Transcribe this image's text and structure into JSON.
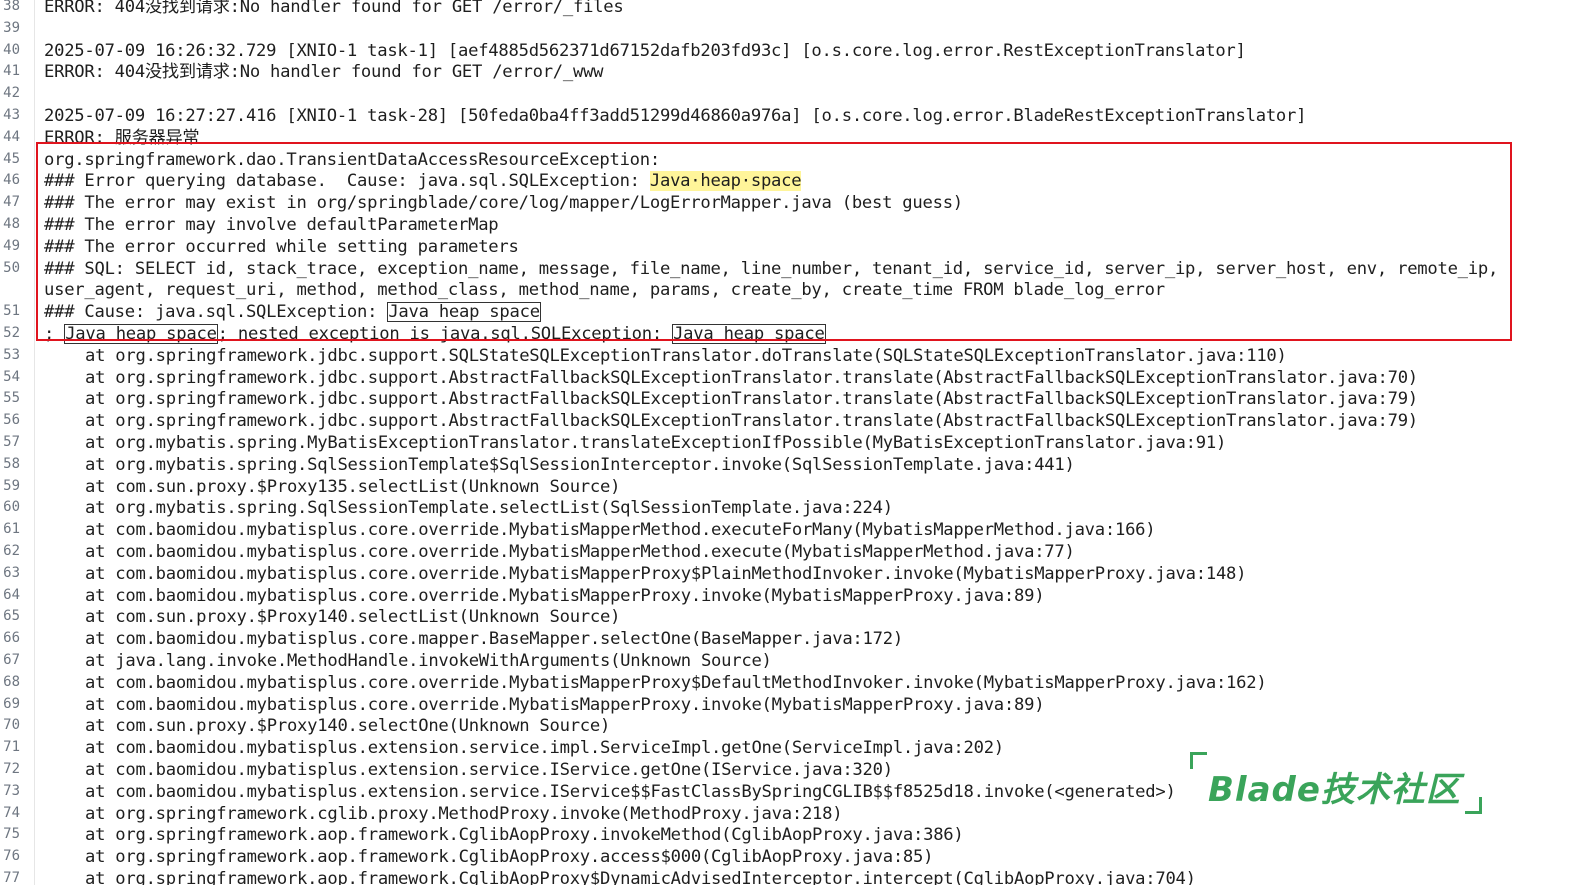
{
  "lines": [
    {
      "n": "38",
      "text": "ERROR: 404没找到请求:No handler found for GET /error/_files"
    },
    {
      "n": "39",
      "text": ""
    },
    {
      "n": "40",
      "text": "2025-07-09 16:26:32.729 [XNIO-1 task-1] [aef4885d562371d67152dafb203fd93c] [o.s.core.log.error.RestExceptionTranslator]"
    },
    {
      "n": "41",
      "text": "ERROR: 404没找到请求:No handler found for GET /error/_www"
    },
    {
      "n": "42",
      "text": ""
    },
    {
      "n": "43",
      "text": "2025-07-09 16:27:27.416 [XNIO-1 task-28] [50feda0ba4ff3add51299d46860a976a] [o.s.core.log.error.BladeRestExceptionTranslator]"
    },
    {
      "n": "44",
      "text": "ERROR: 服务器异常"
    },
    {
      "n": "45",
      "text": "org.springframework.dao.TransientDataAccessResourceException:"
    },
    {
      "n": "46",
      "pre": "### Error querying database.  Cause: java.sql.SQLException: ",
      "highlight": "Java·heap·space"
    },
    {
      "n": "47",
      "text": "### The error may exist in org/springblade/core/log/mapper/LogErrorMapper.java (best guess)"
    },
    {
      "n": "48",
      "text": "### The error may involve defaultParameterMap"
    },
    {
      "n": "49",
      "text": "### The error occurred while setting parameters"
    },
    {
      "n": "50",
      "text": "### SQL: SELECT id, stack_trace, exception_name, message, file_name, line_number, tenant_id, service_id, server_ip, server_host, env, remote_ip,"
    },
    {
      "n": "",
      "text": "user_agent, request_uri, method, method_class, method_name, params, create_by, create_time FROM blade_log_error"
    },
    {
      "n": "51",
      "pre": "### Cause: java.sql.SQLException: ",
      "boxed": "Java heap space"
    },
    {
      "n": "52",
      "pre": "; ",
      "boxed": "Java heap space",
      "mid": "; nested exception is java.sql.SQLException: ",
      "boxed2": "Java heap space"
    },
    {
      "n": "53",
      "text": "at org.springframework.jdbc.support.SQLStateSQLExceptionTranslator.doTranslate(SQLStateSQLExceptionTranslator.java:110)",
      "indent": true
    },
    {
      "n": "54",
      "text": "at org.springframework.jdbc.support.AbstractFallbackSQLExceptionTranslator.translate(AbstractFallbackSQLExceptionTranslator.java:70)",
      "indent": true
    },
    {
      "n": "55",
      "text": "at org.springframework.jdbc.support.AbstractFallbackSQLExceptionTranslator.translate(AbstractFallbackSQLExceptionTranslator.java:79)",
      "indent": true
    },
    {
      "n": "56",
      "text": "at org.springframework.jdbc.support.AbstractFallbackSQLExceptionTranslator.translate(AbstractFallbackSQLExceptionTranslator.java:79)",
      "indent": true
    },
    {
      "n": "57",
      "text": "at org.mybatis.spring.MyBatisExceptionTranslator.translateExceptionIfPossible(MyBatisExceptionTranslator.java:91)",
      "indent": true
    },
    {
      "n": "58",
      "text": "at org.mybatis.spring.SqlSessionTemplate$SqlSessionInterceptor.invoke(SqlSessionTemplate.java:441)",
      "indent": true
    },
    {
      "n": "59",
      "text": "at com.sun.proxy.$Proxy135.selectList(Unknown Source)",
      "indent": true
    },
    {
      "n": "60",
      "text": "at org.mybatis.spring.SqlSessionTemplate.selectList(SqlSessionTemplate.java:224)",
      "indent": true
    },
    {
      "n": "61",
      "text": "at com.baomidou.mybatisplus.core.override.MybatisMapperMethod.executeForMany(MybatisMapperMethod.java:166)",
      "indent": true
    },
    {
      "n": "62",
      "text": "at com.baomidou.mybatisplus.core.override.MybatisMapperMethod.execute(MybatisMapperMethod.java:77)",
      "indent": true
    },
    {
      "n": "63",
      "text": "at com.baomidou.mybatisplus.core.override.MybatisMapperProxy$PlainMethodInvoker.invoke(MybatisMapperProxy.java:148)",
      "indent": true
    },
    {
      "n": "64",
      "text": "at com.baomidou.mybatisplus.core.override.MybatisMapperProxy.invoke(MybatisMapperProxy.java:89)",
      "indent": true
    },
    {
      "n": "65",
      "text": "at com.sun.proxy.$Proxy140.selectList(Unknown Source)",
      "indent": true
    },
    {
      "n": "66",
      "text": "at com.baomidou.mybatisplus.core.mapper.BaseMapper.selectOne(BaseMapper.java:172)",
      "indent": true
    },
    {
      "n": "67",
      "text": "at java.lang.invoke.MethodHandle.invokeWithArguments(Unknown Source)",
      "indent": true
    },
    {
      "n": "68",
      "text": "at com.baomidou.mybatisplus.core.override.MybatisMapperProxy$DefaultMethodInvoker.invoke(MybatisMapperProxy.java:162)",
      "indent": true
    },
    {
      "n": "69",
      "text": "at com.baomidou.mybatisplus.core.override.MybatisMapperProxy.invoke(MybatisMapperProxy.java:89)",
      "indent": true
    },
    {
      "n": "70",
      "text": "at com.sun.proxy.$Proxy140.selectOne(Unknown Source)",
      "indent": true
    },
    {
      "n": "71",
      "text": "at com.baomidou.mybatisplus.extension.service.impl.ServiceImpl.getOne(ServiceImpl.java:202)",
      "indent": true
    },
    {
      "n": "72",
      "text": "at com.baomidou.mybatisplus.extension.service.IService.getOne(IService.java:320)",
      "indent": true
    },
    {
      "n": "73",
      "text": "at com.baomidou.mybatisplus.extension.service.IService$$FastClassBySpringCGLIB$$f8525d18.invoke(<generated>)",
      "indent": true
    },
    {
      "n": "74",
      "text": "at org.springframework.cglib.proxy.MethodProxy.invoke(MethodProxy.java:218)",
      "indent": true
    },
    {
      "n": "75",
      "text": "at org.springframework.aop.framework.CglibAopProxy.invokeMethod(CglibAopProxy.java:386)",
      "indent": true
    },
    {
      "n": "76",
      "text": "at org.springframework.aop.framework.CglibAopProxy.access$000(CglibAopProxy.java:85)",
      "indent": true
    },
    {
      "n": "77",
      "text": "at org.springframework.aop.framework.CglibAopProxy$DynamicAdvisedInterceptor.intercept(CglibAopProxy.java:704)",
      "indent": true
    }
  ],
  "watermark": {
    "text": "Blade技术社区"
  },
  "colors": {
    "highlight": "#fff59a",
    "redbox": "#e0141e",
    "watermark": "#3aa45a"
  }
}
